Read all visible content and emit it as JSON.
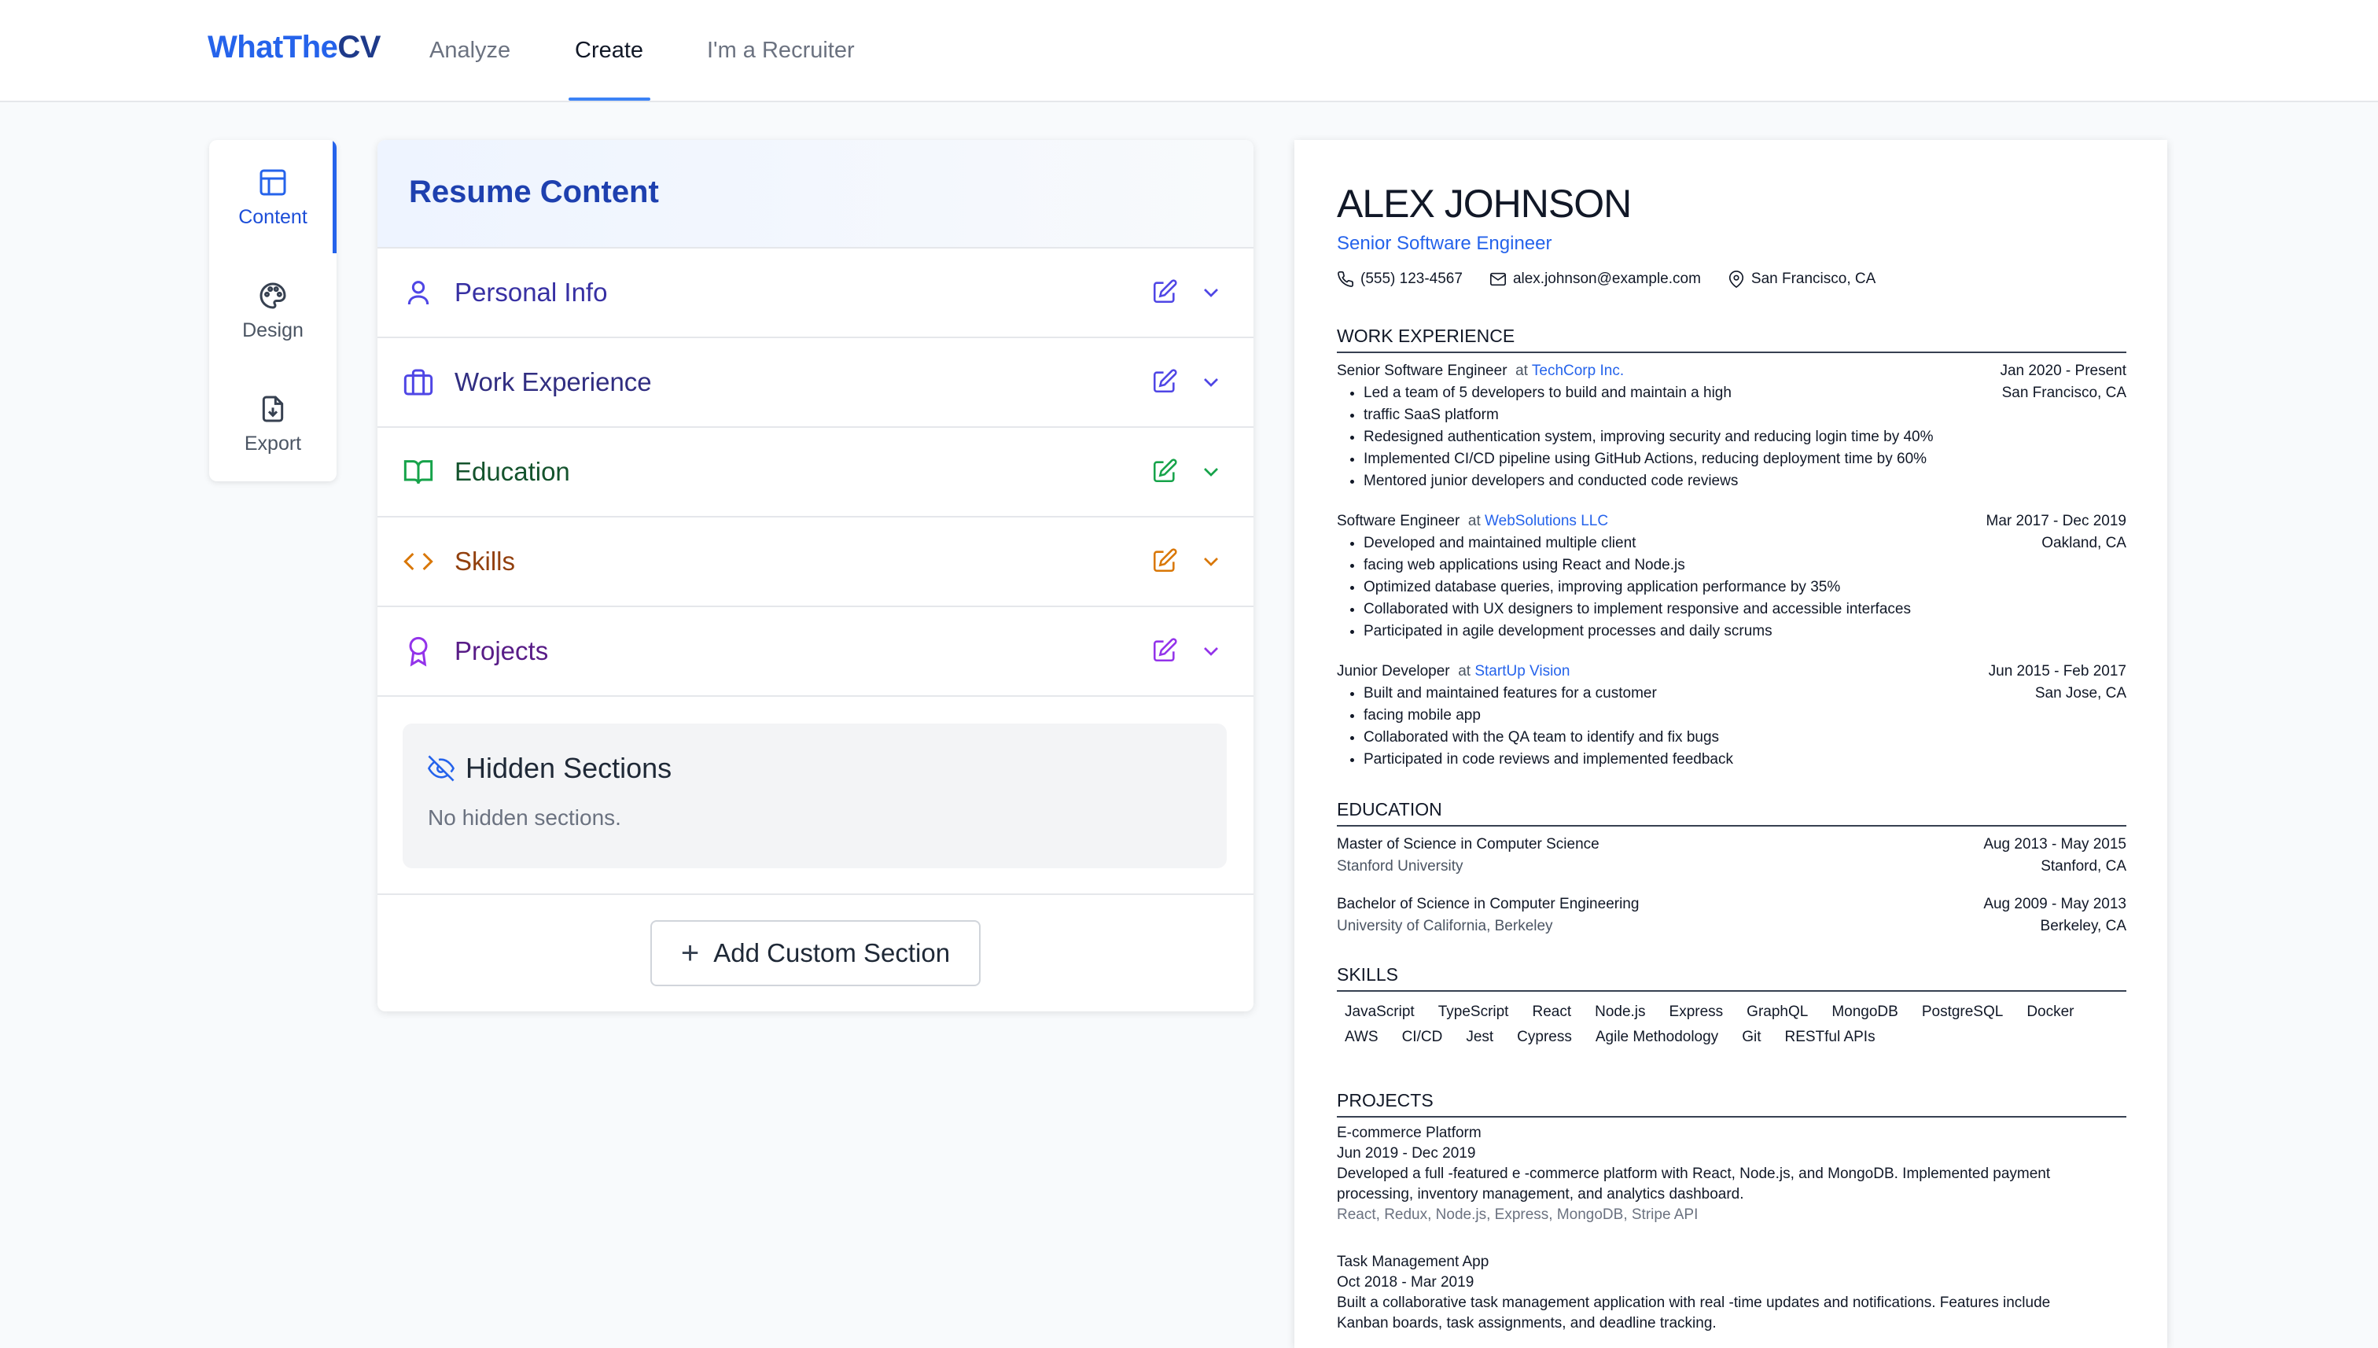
{
  "header": {
    "logo_a": "WhatThe",
    "logo_b": "CV",
    "nav": [
      "Analyze",
      "Create",
      "I'm a Recruiter"
    ],
    "active_nav": "Create"
  },
  "rail": {
    "items": [
      {
        "label": "Content",
        "icon": "layout-icon",
        "active": true
      },
      {
        "label": "Design",
        "icon": "palette-icon"
      },
      {
        "label": "Export",
        "icon": "download-file-icon"
      }
    ]
  },
  "panel": {
    "title": "Resume Content",
    "sections": [
      {
        "label": "Personal Info",
        "icon": "user-icon",
        "color": "#3730a3",
        "icon_color": "#4f46e5"
      },
      {
        "label": "Work Experience",
        "icon": "briefcase-icon",
        "color": "#312e81",
        "icon_color": "#4f46e5"
      },
      {
        "label": "Education",
        "icon": "book-open-icon",
        "color": "#14532d",
        "icon_color": "#16a34a"
      },
      {
        "label": "Skills",
        "icon": "code-icon",
        "color": "#92400e",
        "icon_color": "#d97706"
      },
      {
        "label": "Projects",
        "icon": "award-icon",
        "color": "#581c87",
        "icon_color": "#9333ea"
      }
    ],
    "hidden_title": "Hidden Sections",
    "hidden_msg": "No hidden sections.",
    "add_label": "Add Custom Section"
  },
  "resume": {
    "name": "ALEX JOHNSON",
    "title": "Senior Software Engineer",
    "phone": "(555) 123-4567",
    "email": "alex.johnson@example.com",
    "location": "San Francisco, CA",
    "sections": {
      "work": "WORK EXPERIENCE",
      "education": "EDUCATION",
      "skills": "SKILLS",
      "projects": "PROJECTS"
    },
    "jobs": [
      {
        "role": "Senior Software Engineer",
        "at": "at",
        "company": "TechCorp Inc.",
        "dates": "Jan 2020 - Present",
        "location": "San Francisco, CA",
        "bullets": [
          "Led a team of 5 developers to build and maintain a high",
          "traffic SaaS platform",
          "Redesigned authentication system, improving security and reducing login time by 40%",
          "Implemented CI/CD pipeline using GitHub Actions, reducing deployment time by 60%",
          "Mentored junior developers and conducted code reviews"
        ]
      },
      {
        "role": "Software Engineer",
        "at": "at",
        "company": "WebSolutions LLC",
        "dates": "Mar 2017 - Dec 2019",
        "location": "Oakland, CA",
        "bullets": [
          "Developed and maintained multiple client",
          "facing web applications using React and Node.js",
          "Optimized database queries, improving application performance by 35%",
          "Collaborated with UX designers to implement responsive and accessible interfaces",
          "Participated in agile development processes and daily scrums"
        ]
      },
      {
        "role": "Junior Developer",
        "at": "at",
        "company": "StartUp Vision",
        "dates": "Jun 2015 - Feb 2017",
        "location": "San Jose, CA",
        "bullets": [
          "Built and maintained features for a customer",
          "facing mobile app",
          "Collaborated with the QA team to identify and fix bugs",
          "Participated in code reviews and implemented feedback"
        ]
      }
    ],
    "education": [
      {
        "degree": "Master of Science in Computer Science",
        "school": "Stanford University",
        "dates": "Aug 2013 - May 2015",
        "location": "Stanford, CA"
      },
      {
        "degree": "Bachelor of Science in Computer Engineering",
        "school": "University of California, Berkeley",
        "dates": "Aug 2009 - May 2013",
        "location": "Berkeley, CA"
      }
    ],
    "skills": [
      "JavaScript",
      "TypeScript",
      "React",
      "Node.js",
      "Express",
      "GraphQL",
      "MongoDB",
      "PostgreSQL",
      "Docker",
      "AWS",
      "CI/CD",
      "Jest",
      "Cypress",
      "Agile Methodology",
      "Git",
      "RESTful APIs"
    ],
    "projects": [
      {
        "name": "E-commerce Platform",
        "dates": "Jun 2019 - Dec 2019",
        "desc_1": "Developed a full -featured e -commerce platform with React, Node.js, and MongoDB. Implemented payment",
        "desc_2": "processing, inventory management, and analytics dashboard.",
        "tech": "React, Redux, Node.js, Express, MongoDB, Stripe API"
      },
      {
        "name": "Task Management App",
        "dates": "Oct 2018 - Mar 2019",
        "desc_1": "Built a collaborative task management application with real -time updates and notifications. Features include",
        "desc_2": "Kanban boards, task assignments, and deadline tracking."
      }
    ]
  }
}
